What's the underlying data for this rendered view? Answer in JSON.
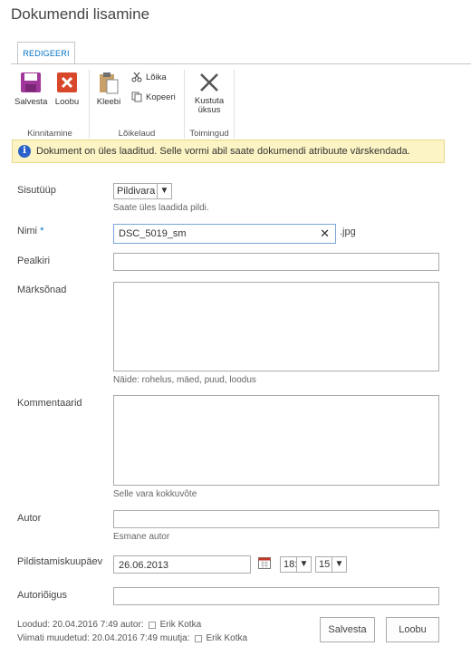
{
  "page": {
    "title": "Dokumendi lisamine"
  },
  "ribbon": {
    "tab": "REDIGEERI",
    "groups": [
      {
        "label": "Kinnitamine",
        "buttons": [
          "Salvesta",
          "Loobu"
        ]
      },
      {
        "label": "Lõikelaud",
        "buttons": [
          "Kleebi",
          "Lõika",
          "Kopeeri"
        ]
      },
      {
        "label": "Toimingud",
        "buttons": [
          "Kustuta",
          "üksus"
        ]
      }
    ]
  },
  "info": {
    "text": "Dokument on üles laaditud. Selle vormi abil saate dokumendi atribuute värskendada."
  },
  "form": {
    "content_type": {
      "label": "Sisutüüp",
      "value": "Pildivara",
      "hint": "Saate üles laadida pildi."
    },
    "name": {
      "label": "Nimi",
      "required": "*",
      "value": "DSC_5019_sm",
      "ext": ".jpg"
    },
    "title": {
      "label": "Pealkiri",
      "value": ""
    },
    "keywords": {
      "label": "Märksõnad",
      "hint": "Näide: rohelus, mäed, puud, loodus"
    },
    "comments": {
      "label": "Kommentaarid",
      "hint": "Selle vara kokkuvõte"
    },
    "author": {
      "label": "Autor",
      "hint": "Esmane autor"
    },
    "date": {
      "label": "Pildistamiskuupäev",
      "value": "26.06.2013",
      "hour": "18:",
      "minute": "15"
    },
    "copyright": {
      "label": "Autoriõigus"
    }
  },
  "footer": {
    "created_prefix": "Loodud: 20.04.2016 7:49  autor:",
    "created_user": "Erik Kotka",
    "modified_prefix": "Viimati muudetud: 20.04.2016 7:49  muutja:",
    "modified_user": "Erik Kotka",
    "save": "Salvesta",
    "cancel": "Loobu"
  },
  "colors": {
    "accent": "#0072c6",
    "info_bg": "#fcf4c4",
    "save_icon": "#a0389b",
    "cancel_icon": "#d9472b"
  }
}
